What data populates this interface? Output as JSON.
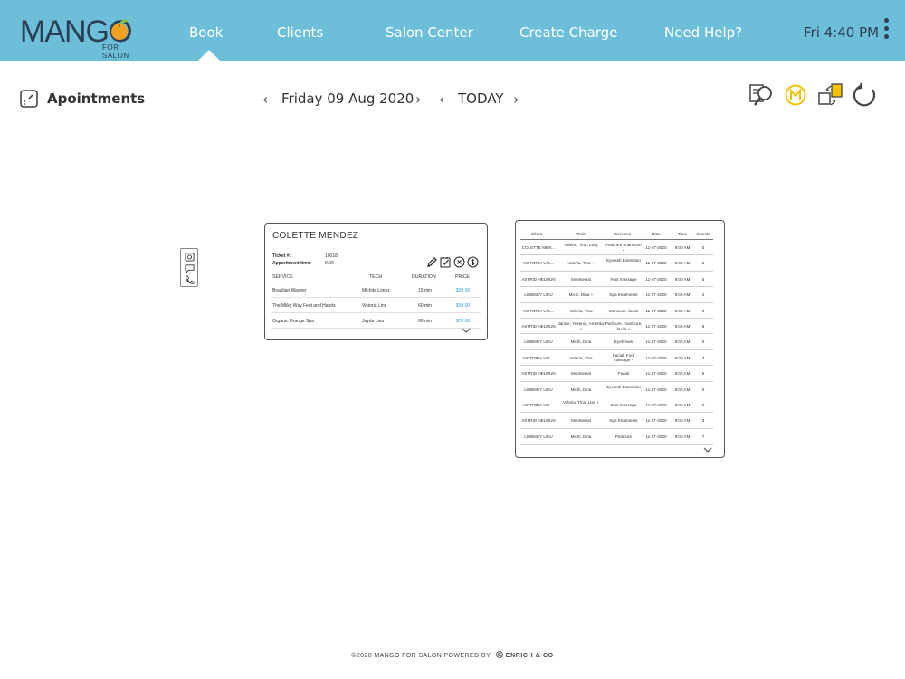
{
  "header": {
    "logo_text": "MANGO",
    "logo_sub": "FOR SALON",
    "nav": [
      {
        "label": "Book"
      },
      {
        "label": "Clients"
      },
      {
        "label": "Salon Center"
      },
      {
        "label": "Create Charge"
      },
      {
        "label": "Need Help?"
      }
    ],
    "clock": "Fri 4:40 PM",
    "bar_color": "#6dbfd9",
    "logo_accent": "#f2a022"
  },
  "toolbar": {
    "title": "Apointments",
    "date": "Friday 09 Aug 2020",
    "today": "TODAY",
    "icons": [
      "search-client-icon",
      "mango-coin-icon",
      "transfer-icon",
      "refresh-icon"
    ]
  },
  "card": {
    "client_name": "COLETTE MENDEZ",
    "ticket_label": "Ticket #:",
    "ticket_value": "10018",
    "time_label": "Apporitment time:",
    "time_value": "9:00",
    "columns": [
      "SERVICE",
      "TECH",
      "DURATION",
      "PRICE"
    ],
    "rows": [
      {
        "service": "Brazilian Waxing",
        "tech": "Michita Lopez",
        "duration": "15 min",
        "price": "$20.00"
      },
      {
        "service": "The Milky Way Feet and Hands",
        "tech": "Victoria Linn",
        "duration": "60 min",
        "price": "$50.00"
      },
      {
        "service": "Organic Orange Spa",
        "tech": "Jayda Lieu",
        "duration": "60 min",
        "price": "$70.00"
      }
    ],
    "price_color": "#2a9fd6"
  },
  "appointments": {
    "columns": [
      "Client",
      "Tech",
      "Services",
      "Date",
      "Time",
      "Guests"
    ],
    "rows": [
      {
        "client": "COLETTE MEN...",
        "tech": "Valeria, Tina, Lucy",
        "services": "Pedicure, manicure +",
        "date": "11-07-2020",
        "time": "9:00 AM",
        "guests": "0"
      },
      {
        "client": "VICTORIA VAL...",
        "tech": "Valeria, Tina +",
        "services": "Eyelash Extension",
        "date": "11-07-2020",
        "time": "9:00 AM",
        "guests": "2"
      },
      {
        "client": "ASTRID HELMUN",
        "tech": "Montserrat",
        "services": "Foot massage",
        "date": "11-07-2020",
        "time": "9:00 AM",
        "guests": "5"
      },
      {
        "client": "LIMBSEY LIEU",
        "tech": "Michi, Dina +",
        "services": "Spa treatments",
        "date": "11-07-2020",
        "time": "9:00 AM",
        "guests": "2"
      },
      {
        "client": "VICTORIA VAL...",
        "tech": "Valeria, Tina",
        "services": "Manicure, facial",
        "date": "11-07-2020",
        "time": "9:00 AM",
        "guests": "0"
      },
      {
        "client": "ASTRID HELMUN",
        "tech": "Janice, Yesenia, Amerika +",
        "services": "Pedicure, manicure, facial +",
        "date": "11-07-2020",
        "time": "9:00 AM",
        "guests": "8"
      },
      {
        "client": "LIMBSEY LIEU",
        "tech": "Michi, Dina",
        "services": "Eyebrows",
        "date": "11-07-2020",
        "time": "9:00 AM",
        "guests": "0"
      },
      {
        "client": "VICTORIA VAL...",
        "tech": "Valeria, Tina",
        "services": "Facial, Foot massage +",
        "date": "11-07-2020",
        "time": "9:00 AM",
        "guests": "3"
      },
      {
        "client": "ASTRID HELMUN",
        "tech": "Montserrat",
        "services": "Facial",
        "date": "11-07-2020",
        "time": "9:00 AM",
        "guests": "5"
      },
      {
        "client": "LIMBSEY LIEU",
        "tech": "Michi, Dina",
        "services": "Eyelash Extension",
        "date": "11-07-2020",
        "time": "9:00 AM",
        "guests": "0"
      },
      {
        "client": "VICTORIA VAL...",
        "tech": "Valeria, Tina, Lisa +",
        "services": "Foot massage",
        "date": "11-07-2020",
        "time": "9:00 AM",
        "guests": "0"
      },
      {
        "client": "ASTRID HELMUN",
        "tech": "Montserrat",
        "services": "Spa treatments",
        "date": "11-07-2020",
        "time": "9:00 AM",
        "guests": "3"
      },
      {
        "client": "LIMBSEY LIEU",
        "tech": "Michi, Dina",
        "services": "Pedicure",
        "date": "11-07-2020",
        "time": "9:00 AM",
        "guests": "7"
      }
    ]
  },
  "footer": {
    "text": "©2020 MANGO FOR SALON POWERED BY",
    "brand": "ENRICH & CO"
  }
}
